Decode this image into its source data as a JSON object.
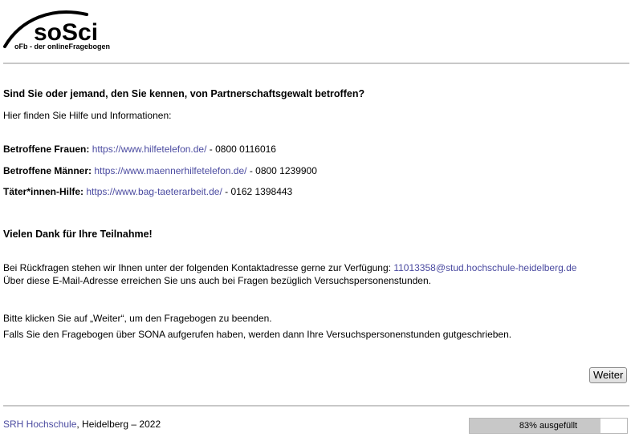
{
  "logo": {
    "name": "soSci",
    "tagline": "oFb - der onlineFragebogen"
  },
  "question": {
    "title": "Sind Sie oder jemand, den Sie kennen, von Partnerschaftsgewalt betroffen?",
    "intro": "Hier finden Sie Hilfe und Informationen:"
  },
  "help": [
    {
      "label": "Betroffene Frauen:",
      "url": "https://www.hilfetelefon.de/",
      "phone": "- 0800 0116016"
    },
    {
      "label": "Betroffene Männer:",
      "url": "https://www.maennerhilfetelefon.de/",
      "phone": "- 0800 1239900"
    },
    {
      "label": "Täter*innen-Hilfe:",
      "url": "https://www.bag-taeterarbeit.de/",
      "phone": "- 0162 1398443"
    }
  ],
  "thanks": "Vielen Dank für Ihre Teilnahme!",
  "contact": {
    "line1": "Bei Rückfragen stehen wir Ihnen unter der folgenden Kontaktadresse gerne zur Verfügung:",
    "email": "11013358@stud.hochschule-heidelberg.de",
    "line2": "Über diese E-Mail-Adresse erreichen Sie uns auch bei Fragen bezüglich Versuchspersonenstunden."
  },
  "finish": {
    "line1": "Bitte klicken Sie auf „Weiter“, um den Fragebogen zu beenden.",
    "line2": "Falls Sie den Fragebogen über SONA aufgerufen haben, werden dann Ihre Versuchspersonenstunden gutgeschrieben."
  },
  "buttons": {
    "next": "Weiter"
  },
  "footer": {
    "link": "SRH Hochschule",
    "text": ", Heidelberg – 2022"
  },
  "progress": {
    "fraction": 0.83,
    "label": "83% ausgefüllt"
  }
}
